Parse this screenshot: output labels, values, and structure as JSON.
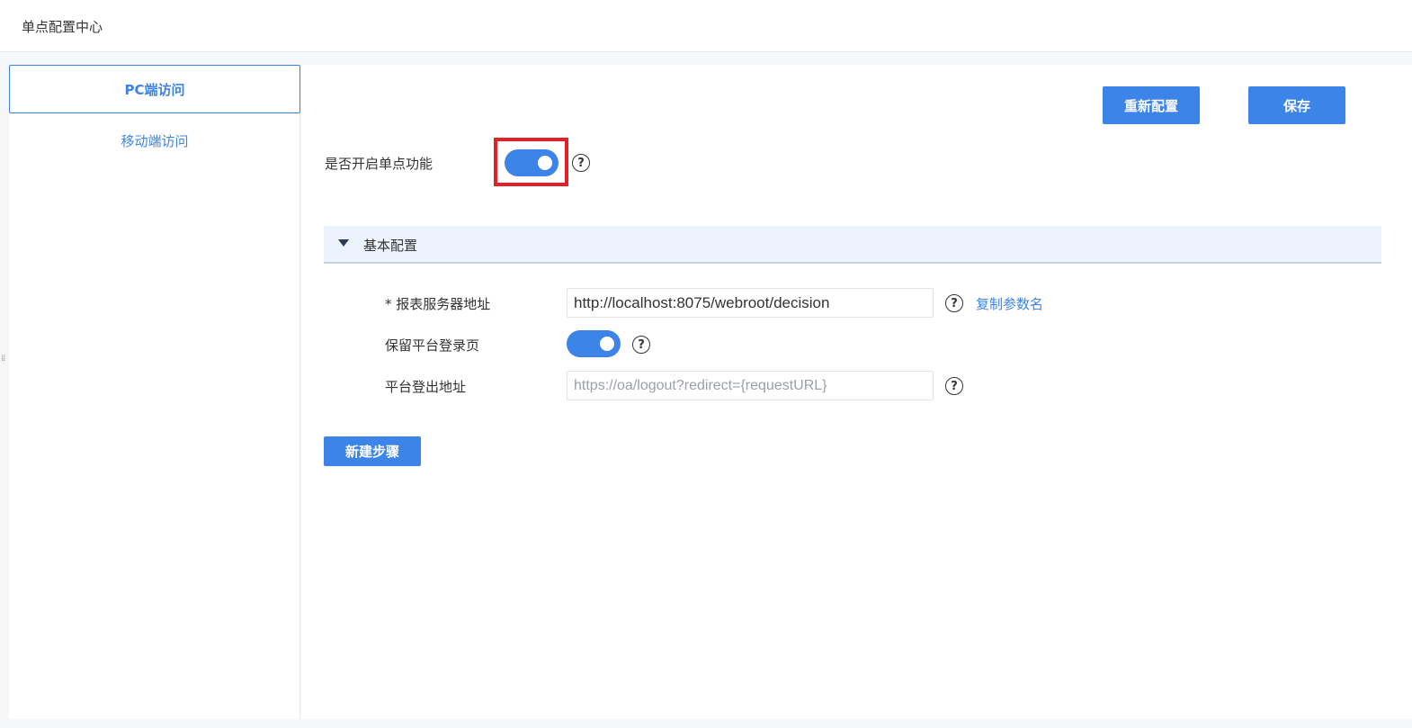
{
  "header": {
    "title": "单点配置中心"
  },
  "sidebar": {
    "items": [
      {
        "label": "PC端访问",
        "active": true
      },
      {
        "label": "移动端访问",
        "active": false
      }
    ]
  },
  "toolbar": {
    "reconfigure_label": "重新配置",
    "save_label": "保存"
  },
  "sso": {
    "enable_label": "是否开启单点功能",
    "enabled": true
  },
  "basic_config": {
    "title": "基本配置",
    "server_address_label": "* 报表服务器地址",
    "server_address_value": "http://localhost:8075/webroot/decision",
    "copy_param_label": "复制参数名",
    "keep_login_label": "保留平台登录页",
    "keep_login_enabled": true,
    "logout_address_label": "平台登出地址",
    "logout_address_placeholder": "https://oa/logout?redirect={requestURL}"
  },
  "actions": {
    "new_step_label": "新建步骤"
  },
  "icons": {
    "help": "help-circle-icon",
    "caret": "caret-down-icon"
  },
  "colors": {
    "accent": "#3d84e8",
    "highlight": "#e61e25"
  }
}
